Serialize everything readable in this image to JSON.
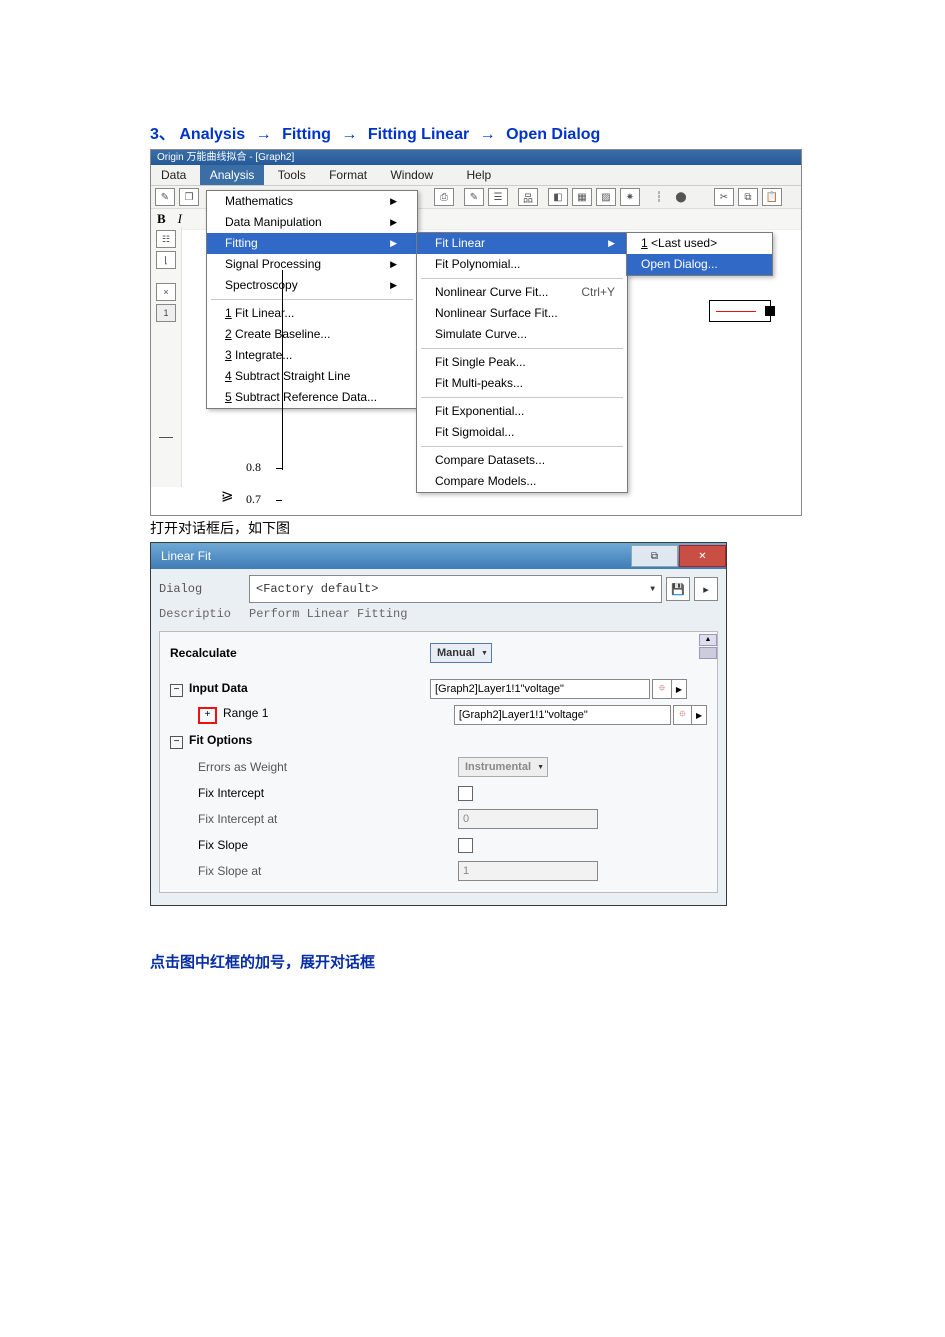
{
  "heading": {
    "num": "3、",
    "p1": "Analysis",
    "p2": "Fitting",
    "p3": "Fitting Linear",
    "p4": "Open Dialog",
    "arrow": "→"
  },
  "shot1": {
    "titlebar": "Origin 万能曲线拟合 - [Graph2]",
    "menu": {
      "data": "Data",
      "analysis": "Analysis",
      "tools": "Tools",
      "format": "Format",
      "window": "Window",
      "help": "Help"
    },
    "row2": {
      "B": "B",
      "I": "I"
    },
    "analysis_menu": [
      {
        "label": "Mathematics",
        "sub": true
      },
      {
        "label": "Data Manipulation",
        "sub": true
      },
      {
        "label": "Fitting",
        "sub": true,
        "hi": true
      },
      {
        "label": "Signal Processing",
        "sub": true
      },
      {
        "label": "Spectroscopy",
        "sub": true
      },
      {
        "sep": true
      },
      {
        "label": "1 Fit Linear...",
        "ul": "1"
      },
      {
        "label": "2 Create Baseline...",
        "ul": "2"
      },
      {
        "label": "3 Integrate...",
        "ul": "3"
      },
      {
        "label": "4 Subtract Straight Line",
        "ul": "4"
      },
      {
        "label": "5 Subtract Reference Data...",
        "ul": "5"
      }
    ],
    "fitting_menu": [
      {
        "label": "Fit Linear",
        "sub": true,
        "hi": true
      },
      {
        "label": "Fit Polynomial..."
      },
      {
        "sep": true
      },
      {
        "label": "Nonlinear Curve Fit...",
        "shortcut": "Ctrl+Y"
      },
      {
        "label": "Nonlinear Surface Fit..."
      },
      {
        "label": "Simulate Curve..."
      },
      {
        "sep": true
      },
      {
        "label": "Fit Single Peak..."
      },
      {
        "label": "Fit Multi-peaks..."
      },
      {
        "sep": true
      },
      {
        "label": "Fit Exponential..."
      },
      {
        "label": "Fit Sigmoidal..."
      },
      {
        "sep": true
      },
      {
        "label": "Compare Datasets..."
      },
      {
        "label": "Compare Models..."
      }
    ],
    "open_menu": [
      {
        "label": "1 <Last used>",
        "ul": "1"
      },
      {
        "label": "Open Dialog...",
        "hi": true
      }
    ],
    "axis": {
      "t1": "0.8",
      "t2": "0.7",
      "one": "1"
    }
  },
  "caption1": "打开对话框后，如下图",
  "dlg": {
    "title": "Linear Fit",
    "dialog_label": "Dialog",
    "theme": "<Factory default>",
    "desc_label": "Descriptio",
    "desc_val": "Perform Linear Fitting",
    "recalc": "Recalculate",
    "recalc_val": "Manual",
    "input_data": "Input Data",
    "input_val": "[Graph2]Layer1!1\"voltage\"",
    "range1": "Range 1",
    "range1_val": "[Graph2]Layer1!1\"voltage\"",
    "fit_options": "Fit Options",
    "errw": "Errors as Weight",
    "errw_val": "Instrumental",
    "fix_int": "Fix Intercept",
    "fix_int_at": "Fix Intercept at",
    "fix_int_at_val": "0",
    "fix_slope": "Fix Slope",
    "fix_slope_at": "Fix Slope at",
    "fix_slope_at_val": "1"
  },
  "footnote": "点击图中红框的加号，展开对话框"
}
